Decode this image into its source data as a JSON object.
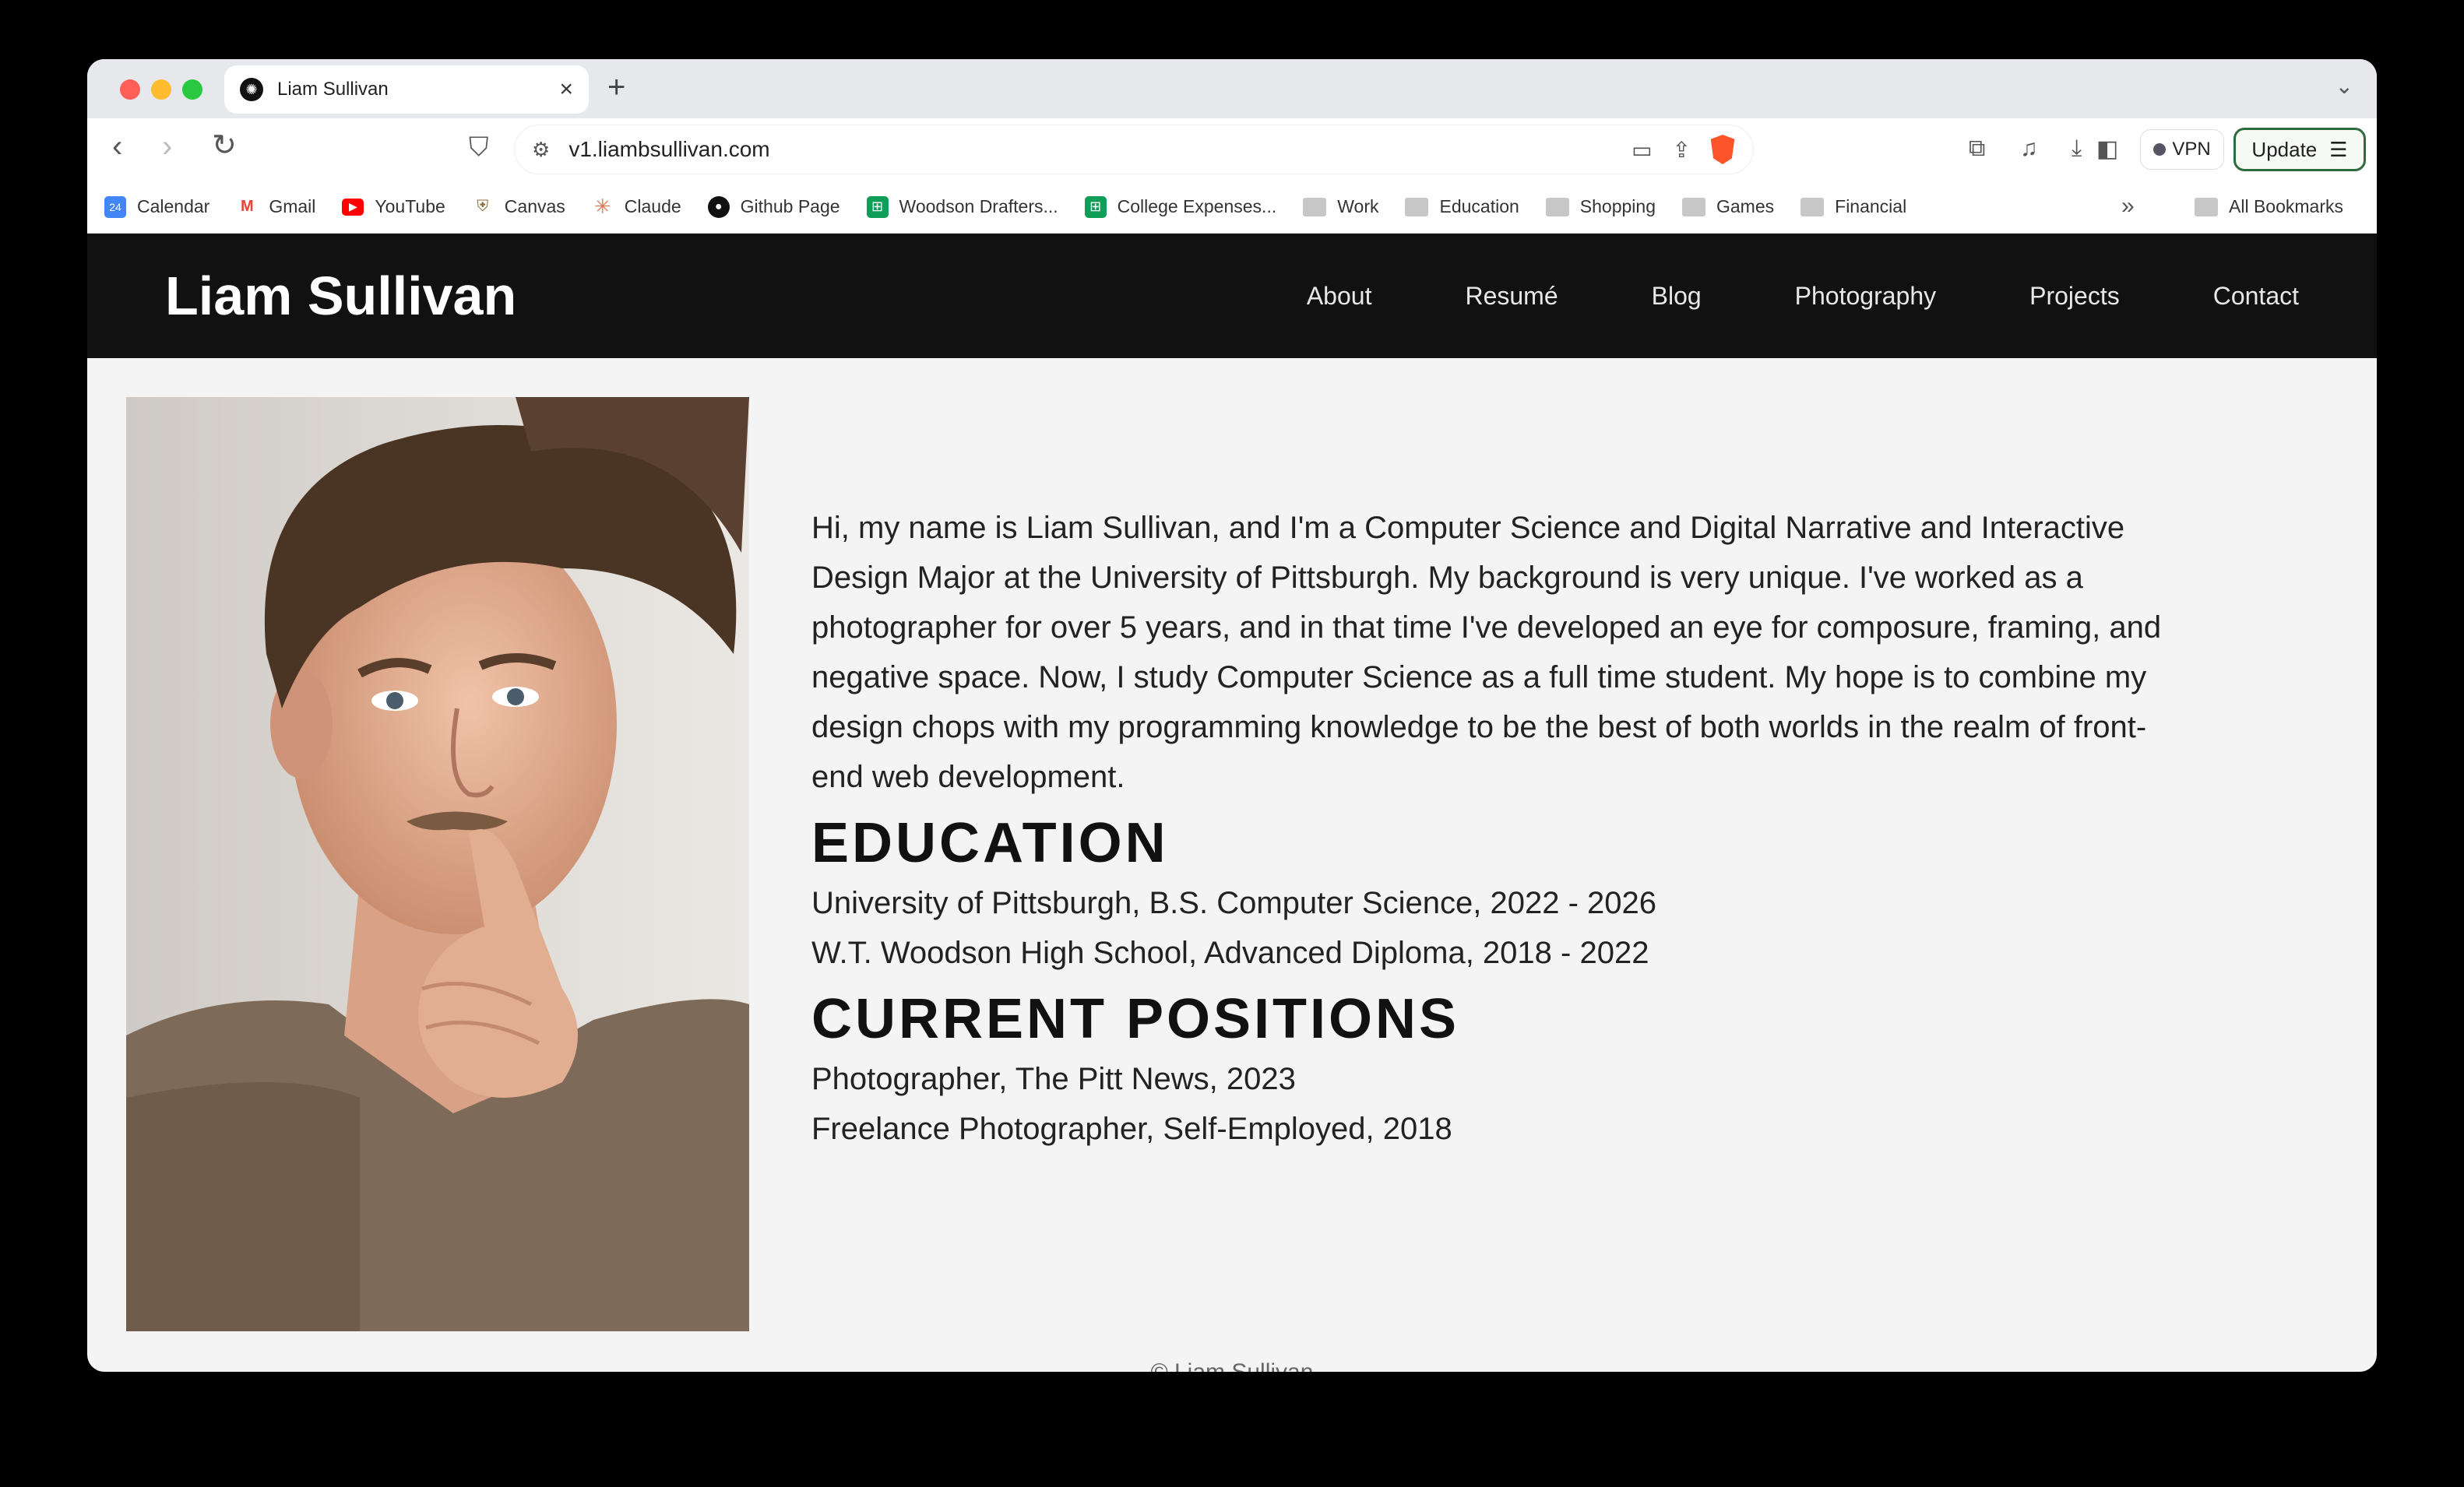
{
  "browser": {
    "tab_title": "Liam Sullivan",
    "url": "v1.liambsullivan.com",
    "vpn_label": "VPN",
    "update_label": "Update"
  },
  "bookmarks": [
    {
      "label": "Calendar",
      "icon": "calendar-icon"
    },
    {
      "label": "Gmail",
      "icon": "gmail-icon"
    },
    {
      "label": "YouTube",
      "icon": "youtube-icon"
    },
    {
      "label": "Canvas",
      "icon": "canvas-icon"
    },
    {
      "label": "Claude",
      "icon": "claude-icon"
    },
    {
      "label": "Github Page",
      "icon": "github-icon"
    },
    {
      "label": "Woodson Drafters...",
      "icon": "sheets-icon"
    },
    {
      "label": "College Expenses...",
      "icon": "sheets-icon"
    },
    {
      "label": "Work",
      "icon": "folder-icon"
    },
    {
      "label": "Education",
      "icon": "folder-icon"
    },
    {
      "label": "Shopping",
      "icon": "folder-icon"
    },
    {
      "label": "Games",
      "icon": "folder-icon"
    },
    {
      "label": "Financial",
      "icon": "folder-icon"
    }
  ],
  "all_bookmarks_label": "All Bookmarks",
  "site": {
    "title": "Liam Sullivan",
    "nav": [
      "About",
      "Resumé",
      "Blog",
      "Photography",
      "Projects",
      "Contact"
    ]
  },
  "main": {
    "bio": "Hi, my name is Liam Sullivan, and I'm a Computer Science and Digital Narrative and Interactive Design Major at the University of Pittsburgh. My background is very unique. I've worked as a photographer for over 5 years, and in that time I've developed an eye for composure, framing, and negative space. Now, I study Computer Science as a full time student. My hope is to combine my design chops with my programming knowledge to be the best of both worlds in the realm of front-end web development.",
    "education_heading": "EDUCATION",
    "education": [
      "University of Pittsburgh, B.S. Computer Science, 2022 - 2026",
      "W.T. Woodson High School, Advanced Diploma, 2018 - 2022"
    ],
    "positions_heading": "CURRENT POSITIONS",
    "positions": [
      "Photographer, The Pitt News, 2023",
      "Freelance Photographer, Self-Employed, 2018"
    ]
  },
  "footer": "© Liam Sullivan",
  "colors": {
    "header_bg": "#111111",
    "page_bg": "#f4f4f4",
    "update_border": "#2e6b3e",
    "brave_orange": "#fb542b"
  }
}
